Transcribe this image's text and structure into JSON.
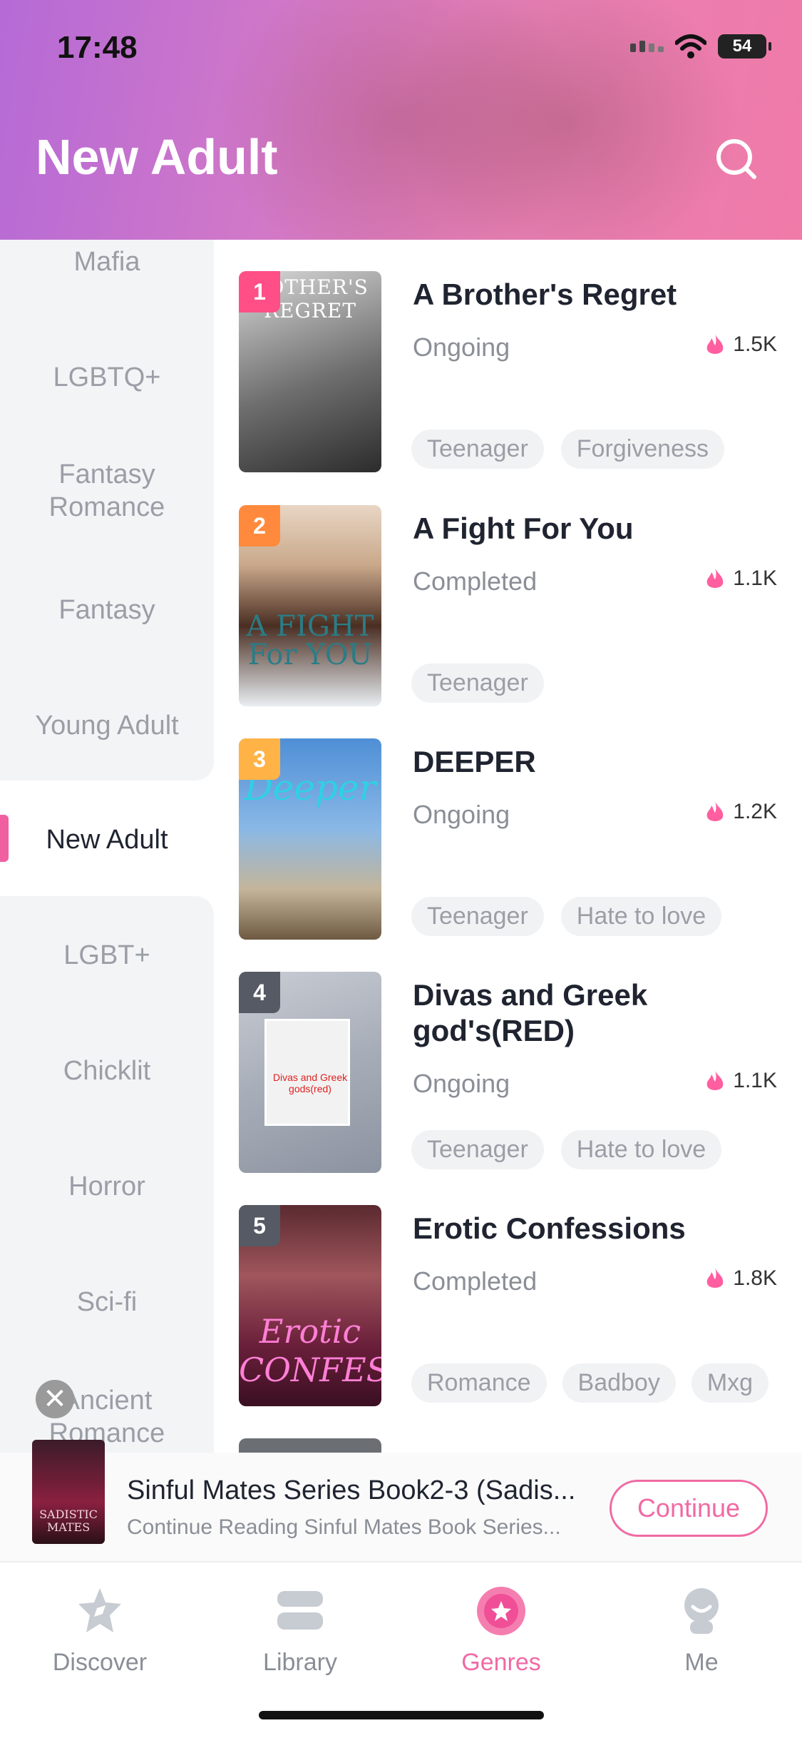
{
  "status_bar": {
    "time": "17:48",
    "battery": "54"
  },
  "header": {
    "title": "New Adult"
  },
  "sidebar": {
    "items": [
      {
        "label": "Mafia"
      },
      {
        "label": "LGBTQ+"
      },
      {
        "label": "Fantasy Romance"
      },
      {
        "label": "Fantasy"
      },
      {
        "label": "Young Adult"
      },
      {
        "label": "New Adult"
      },
      {
        "label": "LGBT+"
      },
      {
        "label": "Chicklit"
      },
      {
        "label": "Horror"
      },
      {
        "label": "Sci-fi"
      },
      {
        "label": "Ancient Romance"
      }
    ],
    "active": "New Adult"
  },
  "books": [
    {
      "rank": "1",
      "title": "A Brother's Regret",
      "status": "Ongoing",
      "heat": "1.5K",
      "tags": [
        "Teenager",
        "Forgiveness"
      ],
      "cover_text": "ROTHER'S REGRET",
      "rank_color": "#ff4f86"
    },
    {
      "rank": "2",
      "title": "A Fight For You",
      "status": "Completed",
      "heat": "1.1K",
      "tags": [
        "Teenager"
      ],
      "cover_text": "A FIGHT For YOU",
      "rank_color": "#ff8a3d"
    },
    {
      "rank": "3",
      "title": "DEEPER",
      "status": "Ongoing",
      "heat": "1.2K",
      "tags": [
        "Teenager",
        "Hate to love"
      ],
      "cover_text": "Deeper",
      "rank_color": "#ffb347"
    },
    {
      "rank": "4",
      "title": "Divas and Greek god's(RED)",
      "status": "Ongoing",
      "heat": "1.1K",
      "tags": [
        "Teenager",
        "Hate to love"
      ],
      "cover_text": "Divas and Greek gods(red)",
      "rank_color": "#555a64"
    },
    {
      "rank": "5",
      "title": "Erotic Confessions",
      "status": "Completed",
      "heat": "1.8K",
      "tags": [
        "Romance",
        "Badboy",
        "Mxg"
      ],
      "cover_text": "Erotic CONFESSIONS",
      "rank_color": "#555a64"
    }
  ],
  "continue_reading": {
    "title": "Sinful Mates Series Book2-3 (Sadis...",
    "subtitle": "Continue Reading Sinful Mates Book Series...",
    "button": "Continue",
    "cover_text": "SADISTIC MATES"
  },
  "bottom_nav": [
    {
      "label": "Discover",
      "icon": "discover-icon"
    },
    {
      "label": "Library",
      "icon": "library-icon"
    },
    {
      "label": "Genres",
      "icon": "genres-icon",
      "active": true
    },
    {
      "label": "Me",
      "icon": "me-icon"
    }
  ],
  "colors": {
    "accent": "#f06aa4",
    "active_bar": "#f060a0"
  }
}
